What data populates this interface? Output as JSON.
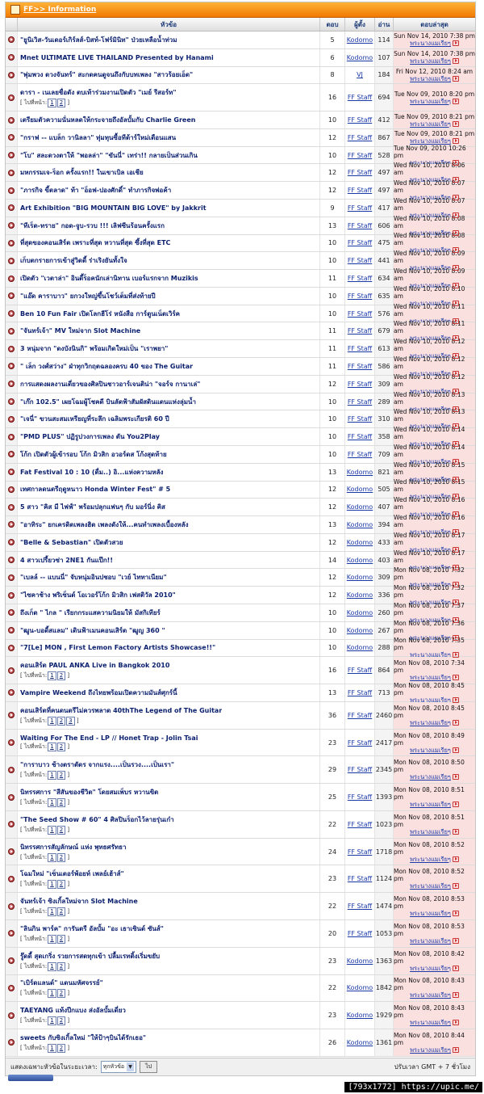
{
  "header": {
    "title": "FF>> Information"
  },
  "columns": {
    "topic": "หัวข้อ",
    "replies": "ตอบ",
    "author": "ผู้ตั้ง",
    "views": "อ่าน",
    "last": "ตอบล่าสุด"
  },
  "pages_prefix": "[ ไปที่หน้า:",
  "pages_suffix": "]",
  "topics": [
    {
      "title": "\"ยูนิเวิส-วันเดอร์เกิร์ลส์-บิสท์-โฟร์มินิท\" ป่วยเหลือน้ำท่วม",
      "replies": "5",
      "author": "Kodomo",
      "views": "114",
      "last_date": "Sun Nov 14, 2010 7:38 pm",
      "last_by": "พระนางแมเรียๆ",
      "pages": []
    },
    {
      "title": "Mnet ULTIMATE LIVE THAILAND Presented by Hanami",
      "replies": "6",
      "author": "Kodomo",
      "views": "107",
      "last_date": "Sun Nov 14, 2010 7:38 pm",
      "last_by": "พระนางแมเรียๆ",
      "pages": []
    },
    {
      "title": "\"พุ่มพวง ดวงจันทร์\" สะกดคนดูจนถึงกับบทเพลง \"สาวร้อยเอ็ด\"",
      "replies": "8",
      "author": "VJ",
      "views": "184",
      "last_date": "Fri Nov 12, 2010 8:24 am",
      "last_by": "พระนางแมเรียๆ",
      "pages": []
    },
    {
      "title": "ดารา - เนเลยชื่อดัง ตบเท้าร่วมงานเปิดตัว \"เมย์ รีสอร์ท\"",
      "replies": "16",
      "author": "FF Staff",
      "views": "694",
      "last_date": "Tue Nov 09, 2010 8:20 pm",
      "last_by": "พระนางแมเรียๆ",
      "pages": [
        "1",
        "2"
      ]
    },
    {
      "title": "เตรียมตัวความนั่นหลดให้กระจายถึงอัลบั้มกับ Charlie Green",
      "replies": "10",
      "author": "FF Staff",
      "views": "412",
      "last_date": "Tue Nov 09, 2010 8:21 pm",
      "last_by": "พระนางแมเรียๆ",
      "pages": []
    },
    {
      "title": "\"กราฟ -- แบล็ก วานิลลา\" ทุ่มทุนซื้อทีต้าร์ใหม่เตือนแสน",
      "replies": "12",
      "author": "FF Staff",
      "views": "867",
      "last_date": "Tue Nov 09, 2010 8:21 pm",
      "last_by": "พระนางแมเรียๆ",
      "pages": []
    },
    {
      "title": "\"โบ\" สละดวงตาให้ \"พอลล่า\" \"ขันนี่\" เทร่า!! กลายเป็นส่วนเกิน",
      "replies": "10",
      "author": "FF Staff",
      "views": "528",
      "last_date": "Tue Nov 09, 2010 10:26 pm",
      "last_by": "พระนางแมเรียๆ",
      "pages": []
    },
    {
      "title": "มหกรรมเจ-ร็อก ครั้งแรก!! ในเขาเบิล เอเชีย",
      "replies": "12",
      "author": "FF Staff",
      "views": "497",
      "last_date": "Wed Nov 10, 2010 8:06 am",
      "last_by": "พระนางแมเรียๆ",
      "pages": []
    },
    {
      "title": "\"ภารกิจ ขี้ตลาด\" ท้า \"อ็อฟ-ปองศักดิ์\" ทำภารกิจพ่อค้า",
      "replies": "12",
      "author": "FF Staff",
      "views": "497",
      "last_date": "Wed Nov 10, 2010 8:07 am",
      "last_by": "พระนางแมเรียๆ",
      "pages": []
    },
    {
      "title": "Art Exhibition \"BIG MOUNTAIN BIG LOVE\" by Jakkrit",
      "replies": "9",
      "author": "FF Staff",
      "views": "417",
      "last_date": "Wed Nov 10, 2010 8:07 am",
      "last_by": "พระนางแมเรียๆ",
      "pages": []
    },
    {
      "title": "\"ทีเร็ต-ทราย\" กอด-จูบ-รวบ !!! เลิฟซีนร้อนครั้งแรก",
      "replies": "13",
      "author": "FF Staff",
      "views": "606",
      "last_date": "Wed Nov 10, 2010 8:08 am",
      "last_by": "พระนางแมเรียๆ",
      "pages": []
    },
    {
      "title": "ที่สุดของคอนเสิร์ต เพราะที่สุด หวานที่สุด ซึ้งที่สุด ETC",
      "replies": "10",
      "author": "FF Staff",
      "views": "475",
      "last_date": "Wed Nov 10, 2010 8:08 am",
      "last_by": "พระนางแมเรียๆ",
      "pages": []
    },
    {
      "title": "เก็บตกรายการเข้าสู่วิดดี้ ร่าเริงยันทั้งใจ",
      "replies": "10",
      "author": "FF Staff",
      "views": "441",
      "last_date": "Wed Nov 10, 2010 8:09 am",
      "last_by": "พระนางแมเรียๆ",
      "pages": []
    },
    {
      "title": "เปิดตัว \"เวตาล่า\" อินดี้ร็อคนักเล่านิทาน เบอร์แรกจาก Muzikis",
      "replies": "11",
      "author": "FF Staff",
      "views": "634",
      "last_date": "Wed Nov 10, 2010 8:09 am",
      "last_by": "พระนางแมเรียๆ",
      "pages": []
    },
    {
      "title": "\"แอ๊ด คาราบาว\" ยกวงใหญ่ขึ้นโชว์เต็มที่ส่งท้ายปี",
      "replies": "10",
      "author": "FF Staff",
      "views": "635",
      "last_date": "Wed Nov 10, 2010 8:10 am",
      "last_by": "พระนางแมเรียๆ",
      "pages": []
    },
    {
      "title": "Ben 10 Fun Fair เปิดโลกฮีโร่ หนังสือ การ์ตูนเน็ตเวิร์ค",
      "replies": "10",
      "author": "FF Staff",
      "views": "576",
      "last_date": "Wed Nov 10, 2010 8:11 am",
      "last_by": "พระนางแมเรียๆ",
      "pages": []
    },
    {
      "title": "\"จันทร์เจ้า\" MV ใหม่จาก Slot Machine",
      "replies": "11",
      "author": "FF Staff",
      "views": "679",
      "last_date": "Wed Nov 10, 2010 8:11 am",
      "last_by": "พระนางแมเรียๆ",
      "pages": []
    },
    {
      "title": "3 หนุ่มจาก \"ดงบังนินกิ\" พร้อมเกิดใหม่เป็น \"เราพยา\"",
      "replies": "11",
      "author": "FF Staff",
      "views": "613",
      "last_date": "Wed Nov 10, 2010 8:12 am",
      "last_by": "พระนางแมเรียๆ",
      "pages": []
    },
    {
      "title": "\" เล็ก วงศ์สว่าง\" ฝ่าทุกวิกฤตฉลองครบ 40 ของ The Guitar",
      "replies": "11",
      "author": "FF Staff",
      "views": "586",
      "last_date": "Wed Nov 10, 2010 8:12 am",
      "last_by": "พระนางแมเรียๆ",
      "pages": []
    },
    {
      "title": "การแสดงผลงานเดี่ยวของศิลปินชาวอาร์เจนติน่า \"จอร์จ กานาเล่\"",
      "replies": "12",
      "author": "FF Staff",
      "views": "309",
      "last_date": "Wed Nov 10, 2010 8:12 am",
      "last_by": "พระนางแมเรียๆ",
      "pages": []
    },
    {
      "title": "\"เก๊ก 102.5\" เผยโฉมผู้โชคดี บินลัดฟ้าสัมผัสดินแดนแห่งลุ่มน้ำ",
      "replies": "10",
      "author": "FF Staff",
      "views": "289",
      "last_date": "Wed Nov 10, 2010 8:13 am",
      "last_by": "พระนางแมเรียๆ",
      "pages": []
    },
    {
      "title": "\"เจนี่\" ขวนสะสมเหรียญที่ระลึก เฉลิมพระเกียรติ 60 ปี",
      "replies": "10",
      "author": "FF Staff",
      "views": "310",
      "last_date": "Wed Nov 10, 2010 8:13 am",
      "last_by": "พระนางแมเรียๆ",
      "pages": []
    },
    {
      "title": "\"PMD PLUS\" ปฏิรูปวงการเพลง ตัน You2Play",
      "replies": "10",
      "author": "FF Staff",
      "views": "358",
      "last_date": "Wed Nov 10, 2010 8:14 am",
      "last_by": "พระนางแมเรียๆ",
      "pages": []
    },
    {
      "title": "โก้ก เปิดตัวผู้เข้ารอบ โก้ก มิวสิก อวอร์ดส โก้งสุดท้าย",
      "replies": "10",
      "author": "FF Staff",
      "views": "709",
      "last_date": "Wed Nov 10, 2010 8:14 am",
      "last_by": "พระนางแมเรียๆ",
      "pages": []
    },
    {
      "title": "Fat Festival 10 : 10 (ตื่ม..) อิ...แห่งความหลัง",
      "replies": "13",
      "author": "Kodomo",
      "views": "821",
      "last_date": "Wed Nov 10, 2010 8:15 am",
      "last_by": "พระนางแมเรียๆ",
      "pages": []
    },
    {
      "title": "เทศกาลดนตรีฤดูหนาว Honda Winter Fest\" # 5",
      "replies": "12",
      "author": "Kodomo",
      "views": "505",
      "last_date": "Wed Nov 10, 2010 8:15 am",
      "last_by": "พระนางแมเรียๆ",
      "pages": []
    },
    {
      "title": "5 สาว \"คิส มี ไฟฟ์\" พร้อมปลุกแฟนๆ กับ มอร์นิ่ง คิส",
      "replies": "12",
      "author": "Kodomo",
      "views": "407",
      "last_date": "Wed Nov 10, 2010 8:16 am",
      "last_by": "พระนางแมเรียๆ",
      "pages": []
    },
    {
      "title": "\"อาทิระ\" ยกเครดิตเพลงฮิต เพลงดังให้...คนทำเพลงเบื้องหลัง",
      "replies": "13",
      "author": "Kodomo",
      "views": "394",
      "last_date": "Wed Nov 10, 2010 8:16 am",
      "last_by": "พระนางแมเรียๆ",
      "pages": []
    },
    {
      "title": "\"Belle & Sebastian\" เปิดตัวสวย",
      "replies": "12",
      "author": "Kodomo",
      "views": "433",
      "last_date": "Wed Nov 10, 2010 8:17 am",
      "last_by": "พระนางแมเรียๆ",
      "pages": []
    },
    {
      "title": "4 สาวเปรี้ยวซ่า 2NE1 กันแป๊ก!!",
      "replies": "14",
      "author": "Kodomo",
      "views": "403",
      "last_date": "Wed Nov 10, 2010 8:17 am",
      "last_by": "พระนางแมเรียๆ",
      "pages": []
    },
    {
      "title": "\"เบลล์ -- แบนนี่\" จับหนุ่มอินปชอบ \"เวย์ ไททาเนียม\"",
      "replies": "12",
      "author": "Kodomo",
      "views": "309",
      "last_date": "Mon Nov 08, 2010 7:32 pm",
      "last_by": "พระนางแมเรียๆ",
      "pages": []
    },
    {
      "title": "\"ไซคาช้าง พริเซ็นต์ โอเวอร์โก้ก มิวสิก เฟสติวัล 2010\"",
      "replies": "12",
      "author": "Kodomo",
      "views": "336",
      "last_date": "Mon Nov 08, 2010 7:32 pm",
      "last_by": "พระนางแมเรียๆ",
      "pages": []
    },
    {
      "title": "ถึงเก็ต \" ไกล \" เรียกกระแสความนิยมให้ มัสกิเทียร์",
      "replies": "10",
      "author": "Kodomo",
      "views": "260",
      "last_date": "Mon Nov 08, 2010 7:37 pm",
      "last_by": "พระนางแมเรียๆ",
      "pages": []
    },
    {
      "title": "\"ฒูน-บอดี้สแลม\" เดินฟ้าเมนคอนเสิร์ต \"ฒูญ 360 \"",
      "replies": "10",
      "author": "Kodomo",
      "views": "267",
      "last_date": "Mon Nov 08, 2010 7:36 pm",
      "last_by": "พระนางแมเรียๆ",
      "pages": []
    },
    {
      "title": "\"7[Le] MON , First Lemon Factory Artists Showcase!!\"",
      "replies": "10",
      "author": "Kodomo",
      "views": "288",
      "last_date": "Mon Nov 08, 2010 7:35 pm",
      "last_by": "พระนางแมเรียๆ",
      "pages": []
    },
    {
      "title": "คอนเสิร์ต PAUL ANKA Live in Bangkok 2010",
      "replies": "16",
      "author": "FF Staff",
      "views": "864",
      "last_date": "Mon Nov 08, 2010 7:34 pm",
      "last_by": "พระนางแมเรียๆ",
      "pages": [
        "1",
        "2"
      ]
    },
    {
      "title": "Vampire Weekend ถึงไทยพร้อมเปิดความมันส์ศุกร์นี้",
      "replies": "13",
      "author": "FF Staff",
      "views": "713",
      "last_date": "Mon Nov 08, 2010 8:45 pm",
      "last_by": "พระนางแมเรียๆ",
      "pages": []
    },
    {
      "title": "คอนเสิร์ตที่คนดนตรีไม่ควรพลาด 40thThe Legend of The Guitar",
      "replies": "36",
      "author": "FF Staff",
      "views": "2460",
      "last_date": "Mon Nov 08, 2010 8:45 pm",
      "last_by": "พระนางแมเรียๆ",
      "pages": [
        "1",
        "2",
        "3"
      ]
    },
    {
      "title": "Waiting For The End - LP // Honet Trap - Jolin Tsai",
      "replies": "23",
      "author": "FF Staff",
      "views": "2417",
      "last_date": "Mon Nov 08, 2010 8:49 pm",
      "last_by": "พระนางแมเรียๆ",
      "pages": [
        "1",
        "2"
      ]
    },
    {
      "title": "\"การาบาว ช้างตราตัดร จากแรง....เป็นรวง....เป็นเรา\"",
      "replies": "29",
      "author": "FF Staff",
      "views": "2345",
      "last_date": "Mon Nov 08, 2010 8:50 pm",
      "last_by": "พระนางแมเรียๆ",
      "pages": [
        "1",
        "2"
      ]
    },
    {
      "title": "นิทรรศการ \"สีสันของชีวิต\" โดยสมเพ็บร หวานขิต",
      "replies": "25",
      "author": "FF Staff",
      "views": "1393",
      "last_date": "Mon Nov 08, 2010 8:51 pm",
      "last_by": "พระนางแมเรียๆ",
      "pages": [
        "1",
        "2"
      ]
    },
    {
      "title": "\"The Seed Show # 60\" 4 ศิลปินร็อกไว้ลายรุ่นเก๋า",
      "replies": "22",
      "author": "FF Staff",
      "views": "1023",
      "last_date": "Mon Nov 08, 2010 8:51 pm",
      "last_by": "พระนางแมเรียๆ",
      "pages": [
        "1",
        "2"
      ]
    },
    {
      "title": "นิทรรศการสัญลักษณ์ แห่ง พุทธศรัทธา",
      "replies": "24",
      "author": "FF Staff",
      "views": "1718",
      "last_date": "Mon Nov 08, 2010 8:52 pm",
      "last_by": "พระนางแมเรียๆ",
      "pages": [
        "1",
        "2"
      ]
    },
    {
      "title": "โฉมใหม่ \"เซ็นเตอร์พ้อยท์ เพลย์เฮ้าส์\"",
      "replies": "23",
      "author": "FF Staff",
      "views": "1124",
      "last_date": "Mon Nov 08, 2010 8:52 pm",
      "last_by": "พระนางแมเรียๆ",
      "pages": [
        "1",
        "2"
      ]
    },
    {
      "title": "จันทร์เจ้า ซิงเกิ้ลใหม่จาก Slot Machine",
      "replies": "22",
      "author": "FF Staff",
      "views": "1474",
      "last_date": "Mon Nov 08, 2010 8:53 pm",
      "last_by": "พระนางแมเรียๆ",
      "pages": [
        "1",
        "2"
      ]
    },
    {
      "title": "\"ลินกิน พาร์ค\" การันตรี อัลบั้ม \"อะ เธาเซินด์ ซันส์\"",
      "replies": "20",
      "author": "FF Staff",
      "views": "1053",
      "last_date": "Mon Nov 08, 2010 8:53 pm",
      "last_by": "พระนางแมเรียๆ",
      "pages": [
        "1",
        "2"
      ]
    },
    {
      "title": "รู๊ดดี้ สุดเกริ่ง รวยการสดทุกเข้า ปลื้มเรทติ้งเริ่มขยับ",
      "replies": "23",
      "author": "Kodomo",
      "views": "1363",
      "last_date": "Mon Nov 08, 2010 8:42 pm",
      "last_by": "พระนางแมเรียๆ",
      "pages": [
        "1",
        "2"
      ]
    },
    {
      "title": "\"เบิร์ดแลนด์\" แดนมหัศจรรย์\"",
      "replies": "22",
      "author": "Kodomo",
      "views": "1842",
      "last_date": "Mon Nov 08, 2010 8:43 pm",
      "last_by": "พระนางแมเรียๆ",
      "pages": [
        "1",
        "2"
      ]
    },
    {
      "title": "TAEYANG แท้งปีกแบง ส่งอัลบั้มเดี่ยว",
      "replies": "23",
      "author": "Kodomo",
      "views": "1929",
      "last_date": "Mon Nov 08, 2010 8:43 pm",
      "last_by": "พระนางแมเรียๆ",
      "pages": [
        "1",
        "2"
      ]
    },
    {
      "title": "sweets กับซิงเกิ้ลใหม่ \"ให้ป้าๆบินได้รักเธอ\"",
      "replies": "26",
      "author": "Kodomo",
      "views": "1361",
      "last_date": "Mon Nov 08, 2010 8:44 pm",
      "last_by": "พระนางแมเรียๆ",
      "pages": [
        "1",
        "2"
      ]
    }
  ],
  "footer": {
    "filter_label": "แสดงเฉพาะหัวข้อในระยะเวลา:",
    "filter_value": "ทุกหัวข้อ",
    "go_label": "ไป",
    "timezone": "ปรับเวลา GMT + 7 ชั่วโมง"
  },
  "watermark": "[793x1772] https://upic.me/"
}
